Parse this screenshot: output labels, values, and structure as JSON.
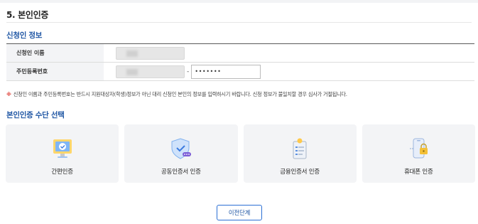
{
  "step": {
    "title": "5. 본인인증"
  },
  "applicant": {
    "section_title": "신청인 정보",
    "name_label": "신청인 이름",
    "rrn_label": "주민등록번호",
    "rrn_separator": "-",
    "rrn_back_value": "•••••••"
  },
  "notice": {
    "mark": "※",
    "text": "신청인 이름과 주민등록번호는 반드시 지원대상자(학생)정보가 아닌 대리 신청인 본인의 정보를 입력하시기 바랍니다. 신청 정보가 불일치할 경우 심사가 거절됩니다."
  },
  "auth": {
    "section_title": "본인인증 수단 선택",
    "methods": [
      {
        "label": "간편인증",
        "icon": "monitor-check-icon"
      },
      {
        "label": "공동인증서 인증",
        "icon": "shield-certificate-icon"
      },
      {
        "label": "금융인증서 인증",
        "icon": "clipboard-certificate-icon"
      },
      {
        "label": "휴대폰 인증",
        "icon": "phone-lock-icon"
      }
    ]
  },
  "buttons": {
    "prev_label": "이전단계"
  },
  "colors": {
    "accent": "#1f56a4",
    "button_border": "#2b6fd4",
    "notice_mark": "#e0473f",
    "card_bg": "#f3f4f6"
  }
}
